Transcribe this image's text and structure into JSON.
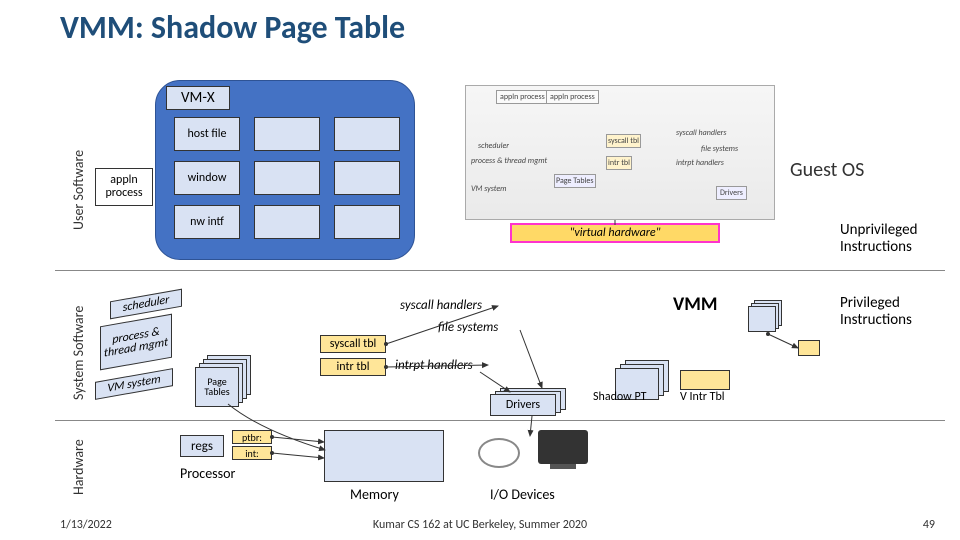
{
  "slide": {
    "title": "VMM: Shadow Page Table",
    "date": "1/13/2022",
    "footer": "Kumar CS 162 at UC Berkeley, Summer 2020",
    "page": "49"
  },
  "rows": {
    "user": "User Software",
    "system": "System Software",
    "hardware": "Hardware"
  },
  "user": {
    "appln": "appln process",
    "vmx": "VM-X",
    "hostfile": "host file",
    "window": "window",
    "nwintf": "nw intf",
    "guest_os": "Guest OS",
    "virtual_hw": "\"virtual hardware\"",
    "unpriv": "Unprivileged Instructions"
  },
  "guest_mini": {
    "p1": "appln process",
    "p2": "appln process",
    "sched": "scheduler",
    "ptm": "process & thread mgmt",
    "vms": "VM system",
    "pt": "Page Tables",
    "sh": "syscall handlers",
    "fs": "file systems",
    "st": "syscall tbl",
    "it": "intr tbl",
    "ih": "intrpt handlers",
    "drv": "Drivers"
  },
  "system": {
    "scheduler": "scheduler",
    "ptm": "process & thread mgmt",
    "vmsystem": "VM system",
    "page_tables": "Page Tables",
    "syscall_tbl": "syscall tbl",
    "intr_tbl": "intr tbl",
    "syscall_handlers": "syscall handlers",
    "file_systems": "file systems",
    "intrpt_handlers": "intrpt handlers",
    "drivers": "Drivers",
    "vmm": "VMM",
    "shadow_pt": "Shadow PT",
    "vintr_tbl": "V Intr Tbl",
    "priv": "Privileged Instructions"
  },
  "hardware": {
    "regs": "regs",
    "ptbr": "ptbr:",
    "int": "int:",
    "processor": "Processor",
    "memory": "Memory",
    "io": "I/O Devices"
  }
}
